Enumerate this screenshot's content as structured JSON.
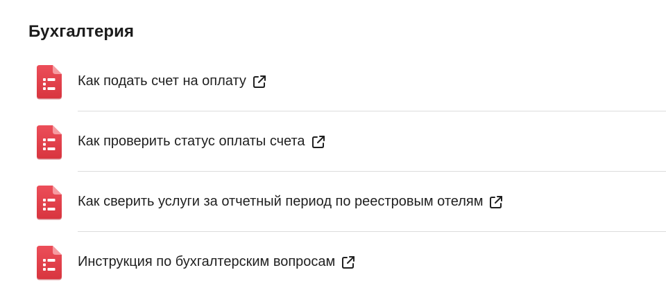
{
  "section": {
    "title": "Бухгалтерия"
  },
  "colors": {
    "icon_red": "#e5434f",
    "icon_red_dark": "#c9303b",
    "divider": "#dcdcdc",
    "text": "#1f1f1f"
  },
  "items": [
    {
      "label": "Как подать счет на оплату",
      "icon": "document-icon",
      "link_icon": "external-link-icon"
    },
    {
      "label": "Как проверить статус оплаты счета",
      "icon": "document-icon",
      "link_icon": "external-link-icon"
    },
    {
      "label": "Как сверить услуги за отчетный период по реестровым отелям",
      "icon": "document-icon",
      "link_icon": "external-link-icon"
    },
    {
      "label": "Инструкция по бухгалтерским вопросам",
      "icon": "document-icon",
      "link_icon": "external-link-icon"
    }
  ]
}
